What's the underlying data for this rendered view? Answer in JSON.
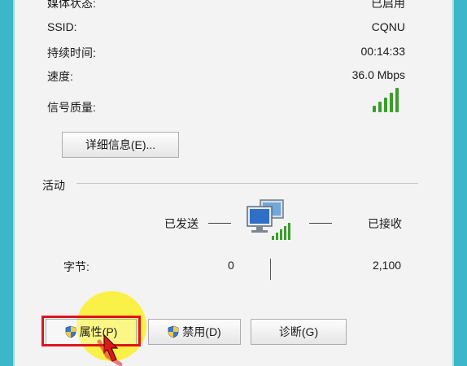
{
  "details": [
    {
      "label": "媒体状态:",
      "value": "已启用"
    },
    {
      "label": "SSID:",
      "value": "CQNU"
    },
    {
      "label": "持续时间:",
      "value": "00:14:33"
    },
    {
      "label": "速度:",
      "value": "36.0 Mbps"
    }
  ],
  "signal_quality": {
    "label": "信号质量:",
    "level_bars": 5,
    "level_max": 5,
    "icon": "signal-bars-icon",
    "color": "#3a9d2b"
  },
  "details_button": "详细信息(E)...",
  "activity": {
    "section_title": "活动",
    "sent_label": "已发送",
    "received_label": "已接收",
    "bytes_label": "字节:",
    "bytes_sent": "0",
    "bytes_received": "2,100",
    "icon": "network-computer-icon"
  },
  "buttons": {
    "properties": "属性(P)",
    "disable": "禁用(D)",
    "diagnose": "诊断(G)"
  },
  "colors": {
    "frame": "#3bb7c9",
    "highlight_box": "#e0141e",
    "highlight_circle": "#faf028",
    "signal": "#3a9d2b"
  }
}
